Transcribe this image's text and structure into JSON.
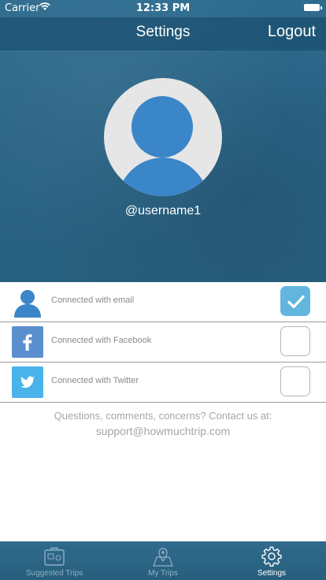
{
  "status_bar": {
    "carrier": "Carrier",
    "time": "12:33 PM"
  },
  "nav": {
    "title": "Settings",
    "logout_label": "Logout"
  },
  "profile": {
    "username": "@username1"
  },
  "connections": [
    {
      "label": "Connected with email",
      "icon": "user-icon",
      "checked": true,
      "color": "#ffffff"
    },
    {
      "label": "Connected with Facebook",
      "icon": "facebook-icon",
      "checked": false,
      "color": "#5b8ecf"
    },
    {
      "label": "Connected with Twitter",
      "icon": "twitter-icon",
      "checked": false,
      "color": "#4ab3ea"
    }
  ],
  "contact": {
    "question": "Questions, comments, concerns?  Contact us at:",
    "email": "support@howmuchtrip.com"
  },
  "tabs": [
    {
      "label": "Suggested Trips",
      "icon": "suitcase-icon",
      "active": false
    },
    {
      "label": "My Trips",
      "icon": "map-pin-icon",
      "active": false
    },
    {
      "label": "Settings",
      "icon": "gear-icon",
      "active": true
    }
  ],
  "colors": {
    "accent": "#62b6de",
    "avatar_blue": "#3a86c8",
    "header_blue": "#2a6487"
  }
}
